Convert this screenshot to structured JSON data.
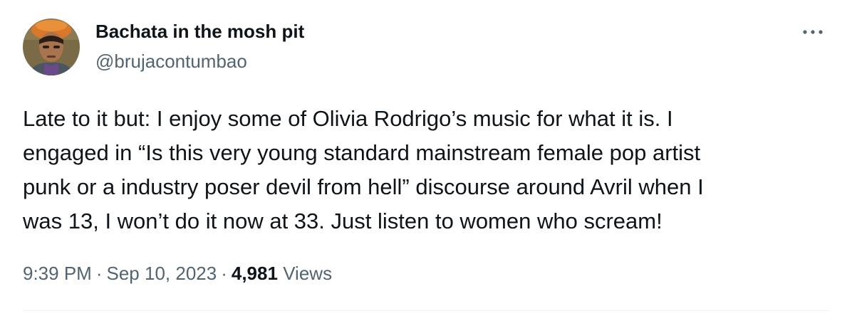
{
  "author": {
    "display_name": "Bachata in the mosh pit",
    "handle": "@brujacontumbao",
    "avatar_icon": "user-avatar-photo"
  },
  "tweet": {
    "text": "Late to it but: I enjoy some of Olivia Rodrigo’s music for what it is. I\nengaged in “Is this very young standard mainstream female pop artist\npunk or a industry poser devil from hell” discourse around Avril when I\nwas 13, I won’t do it now at 33. Just listen to women who scream!"
  },
  "meta": {
    "time": "9:39 PM",
    "separator": "·",
    "date": "Sep 10, 2023",
    "views_count": "4,981",
    "views_label": "Views"
  },
  "menu": {
    "more_icon": "more-horizontal-icon"
  },
  "colors": {
    "primary_text": "#0f1419",
    "secondary_text": "#536471",
    "divider": "#eff3f4"
  }
}
